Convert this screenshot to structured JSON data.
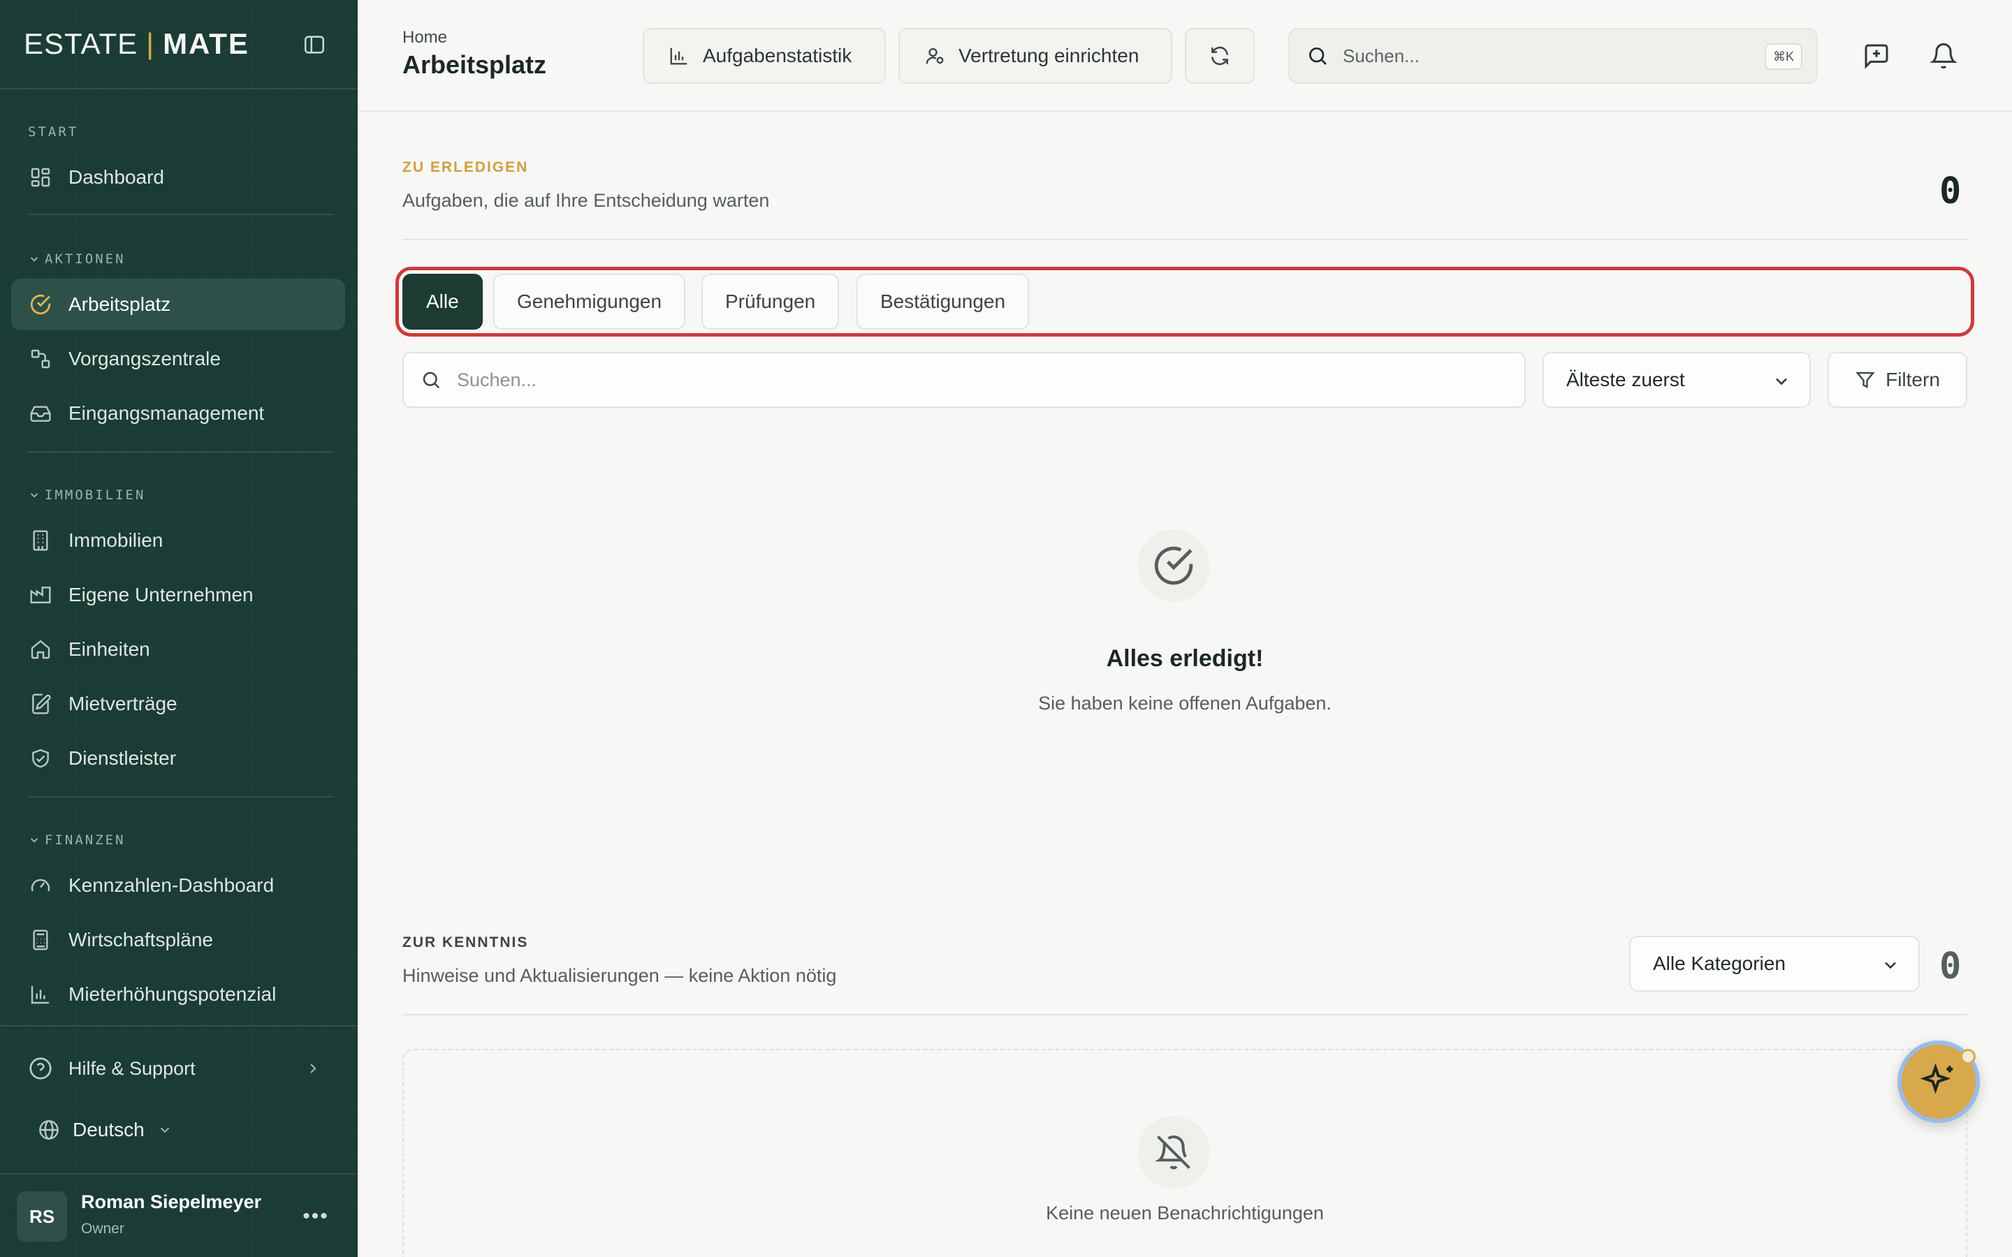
{
  "brand": {
    "left": "ESTATE",
    "separator": "|",
    "right": "MATE"
  },
  "sidebar": {
    "sections": {
      "start": "START",
      "aktionen": "AKTIONEN",
      "immobilien": "IMMOBILIEN",
      "finanzen": "FINANZEN"
    },
    "items": [
      {
        "label": "Dashboard",
        "icon": "dashboard-grid-icon"
      },
      {
        "label": "Arbeitsplatz",
        "icon": "check-circle-icon",
        "active": true
      },
      {
        "label": "Vorgangszentrale",
        "icon": "workflow-icon"
      },
      {
        "label": "Eingangsmanagement",
        "icon": "inbox-icon"
      },
      {
        "label": "Immobilien",
        "icon": "building-icon"
      },
      {
        "label": "Eigene Unternehmen",
        "icon": "factory-icon"
      },
      {
        "label": "Einheiten",
        "icon": "home-icon"
      },
      {
        "label": "Mietverträge",
        "icon": "contract-edit-icon"
      },
      {
        "label": "Dienstleister",
        "icon": "handshake-icon"
      },
      {
        "label": "Kennzahlen-Dashboard",
        "icon": "gauge-icon"
      },
      {
        "label": "Wirtschaftspläne",
        "icon": "calculator-icon"
      },
      {
        "label": "Mieterhöhungspotenzial",
        "icon": "bar-chart-icon"
      }
    ],
    "help": "Hilfe & Support",
    "language": "Deutsch",
    "user": {
      "initials": "RS",
      "name": "Roman Siepelmeyer",
      "role": "Owner"
    }
  },
  "topbar": {
    "breadcrumb": "Home",
    "title": "Arbeitsplatz",
    "stats_button": "Aufgabenstatistik",
    "delegate_button": "Vertretung einrichten",
    "search_placeholder": "Suchen...",
    "shortcut": "⌘K"
  },
  "todo": {
    "eyebrow": "ZU ERLEDIGEN",
    "subtitle": "Aufgaben, die auf Ihre Entscheidung warten",
    "count": "0",
    "tabs": [
      "Alle",
      "Genehmigungen",
      "Prüfungen",
      "Bestätigungen"
    ],
    "active_tab": "Alle",
    "search_placeholder": "Suchen...",
    "sort_value": "Älteste zuerst",
    "filter_label": "Filtern",
    "empty_title": "Alles erledigt!",
    "empty_subtitle": "Sie haben keine offenen Aufgaben."
  },
  "info": {
    "eyebrow": "ZUR KENNTNIS",
    "subtitle": "Hinweise und Aktualisierungen — keine Aktion nötig",
    "category_value": "Alle Kategorien",
    "count": "0",
    "empty_text": "Keine neuen Benachrichtigungen"
  },
  "colors": {
    "sidebar_bg": "#1a3c34",
    "accent_gold": "#d8a84c",
    "active_tab_bg": "#1c3b33",
    "highlight_frame": "#cf3b3b"
  }
}
